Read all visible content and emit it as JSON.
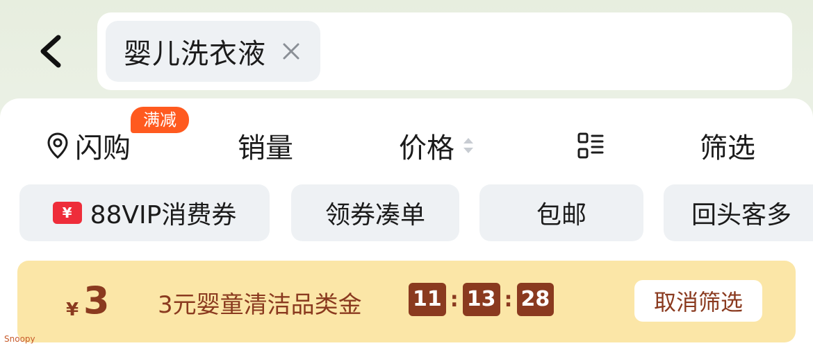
{
  "search": {
    "chip_text": "婴儿洗衣液"
  },
  "sort_bar": {
    "flash": "闪购",
    "flash_badge": "满减",
    "sales": "销量",
    "price": "价格",
    "filter": "筛选"
  },
  "pills": {
    "vip": "88VIP消费券",
    "vip_icon_glyph": "¥",
    "coupon": "领券凑单",
    "free_ship": "包邮",
    "repeat": "回头客多"
  },
  "coupon_banner": {
    "currency": "¥",
    "amount": "3",
    "text": "3元婴童清洁品类金",
    "timer": [
      "11",
      "13",
      "28"
    ],
    "cancel_label": "取消筛选"
  },
  "watermark": "Snoopy",
  "colors": {
    "badge": "#ff5a1f",
    "banner_bg": "#fbe6a7",
    "banner_text": "#8a3a1f",
    "pill_bg": "#eef1f4",
    "vip_icon": "#ee2d3a"
  }
}
